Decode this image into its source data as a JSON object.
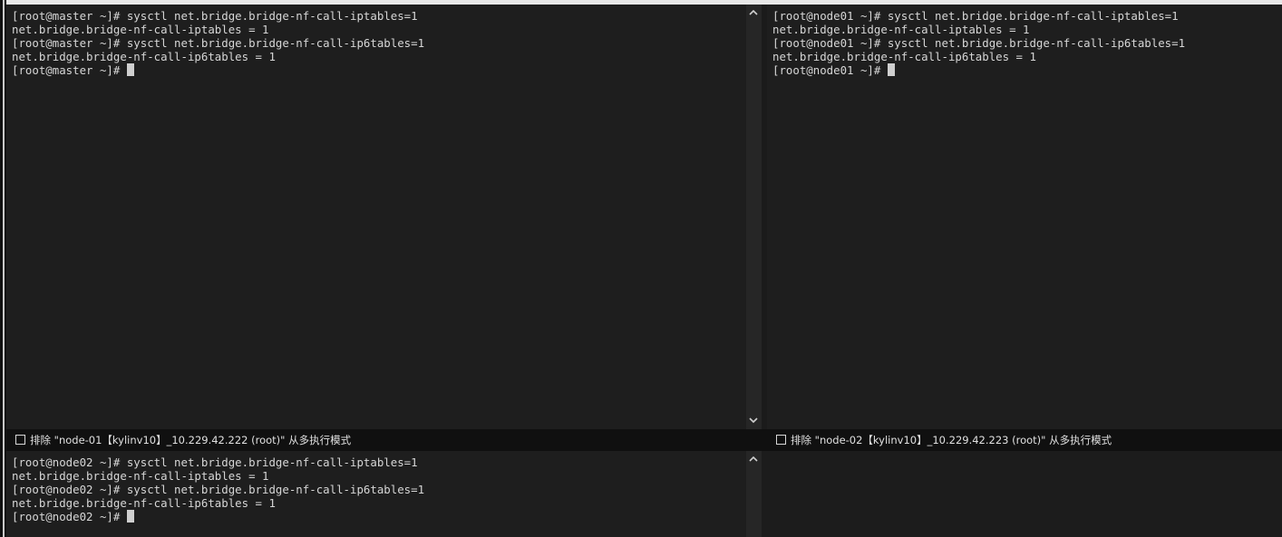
{
  "panes": {
    "master": {
      "lines": [
        "[root@master ~]# sysctl net.bridge.bridge-nf-call-iptables=1",
        "net.bridge.bridge-nf-call-iptables = 1",
        "[root@master ~]# sysctl net.bridge.bridge-nf-call-ip6tables=1",
        "net.bridge.bridge-nf-call-ip6tables = 1"
      ],
      "prompt": "[root@master ~]# "
    },
    "node01": {
      "lines": [
        "[root@node01 ~]# sysctl net.bridge.bridge-nf-call-iptables=1",
        "net.bridge.bridge-nf-call-iptables = 1",
        "[root@node01 ~]# sysctl net.bridge.bridge-nf-call-ip6tables=1",
        "net.bridge.bridge-nf-call-ip6tables = 1"
      ],
      "prompt": "[root@node01 ~]# "
    },
    "node02": {
      "lines": [
        "[root@node02 ~]# sysctl net.bridge.bridge-nf-call-iptables=1",
        "net.bridge.bridge-nf-call-iptables = 1",
        "[root@node02 ~]# sysctl net.bridge.bridge-nf-call-ip6tables=1",
        "net.bridge.bridge-nf-call-ip6tables = 1"
      ],
      "prompt": "[root@node02 ~]# "
    }
  },
  "exclude_bars": {
    "node01": {
      "label": "排除 \"node-01【kylinv10】_10.229.42.222 (root)\" 从多执行模式",
      "checked": false
    },
    "node02": {
      "label": "排除 \"node-02【kylinv10】_10.229.42.223 (root)\" 从多执行模式",
      "checked": false
    }
  },
  "icons": {
    "scroll_up": "chevron-up-icon",
    "scroll_down": "chevron-down-icon"
  },
  "colors": {
    "terminal_bg": "#1e1e1e",
    "terminal_fg": "#d6d6d6",
    "bar_bg": "#101010"
  }
}
